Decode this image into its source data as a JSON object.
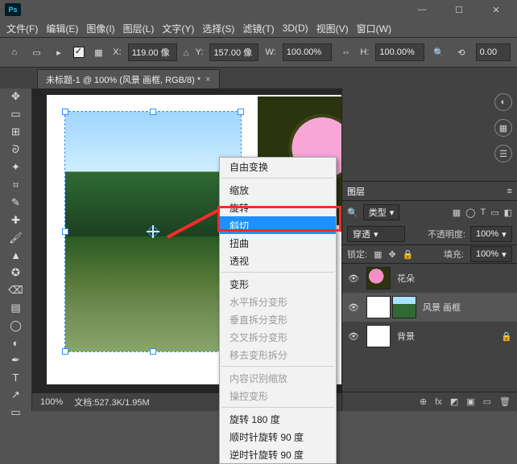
{
  "app": {
    "badge": "Ps"
  },
  "window_controls": {
    "min": "—",
    "max": "☐",
    "close": "✕"
  },
  "menu": [
    "文件(F)",
    "编辑(E)",
    "图像(I)",
    "图层(L)",
    "文字(Y)",
    "选择(S)",
    "滤镜(T)",
    "3D(D)",
    "视图(V)",
    "窗口(W)"
  ],
  "options": {
    "x_label": "X:",
    "x_value": "119.00 像",
    "y_label": "Y:",
    "y_value": "157.00 像",
    "w_label": "W:",
    "w_value": "100.00%",
    "h_label": "H:",
    "h_value": "100.00%",
    "angle": "0.00"
  },
  "doc_tab": {
    "title": "未标题-1 @ 100% (风景 画框, RGB/8) *",
    "close": "×"
  },
  "tools": {
    "move": "✥",
    "marquee": "▭",
    "frame": "⊞",
    "lasso": "ᘐ",
    "wand": "✦",
    "crop": "⌗",
    "eyedrop": "✎",
    "heal": "✚",
    "brush": "🖌",
    "stamp": "▲",
    "history": "✪",
    "eraser": "⌫",
    "grad": "▤",
    "blur": "◯",
    "dodge": "◐",
    "pen": "✒",
    "type": "T",
    "path": "↗",
    "shape": "▭",
    "hand": "✋",
    "zoom": "🔍"
  },
  "status": {
    "zoom": "100%",
    "doc": "文档:527.3K/1.95M"
  },
  "context_menu": {
    "free": "自由变换",
    "scale": "缩放",
    "rotate": "旋转",
    "skew": "斜切",
    "distort": "扭曲",
    "perspective": "透视",
    "warp": "变形",
    "hwarp": "水平拆分变形",
    "vwarp": "垂直拆分变形",
    "xwarp": "交叉拆分变形",
    "rmwarp": "移去变形拆分",
    "cas": "内容识别缩放",
    "puppet": "操控变形",
    "r180": "旋转 180 度",
    "rcw": "顺时针旋转 90 度",
    "rccw": "逆时针旋转 90 度"
  },
  "panels": {
    "tab_layers": "图层",
    "search_ph": "类型",
    "kind_icons": [
      "▦",
      "◯",
      "T",
      "▭",
      "◧"
    ],
    "blend": "穿透",
    "opacity_label": "不透明度:",
    "opacity": "100%",
    "lock_label": "锁定:",
    "fill_label": "填充:",
    "fill": "100%",
    "layer_flowers": "花朵",
    "layer_frame": "风景 画框",
    "layer_bg": "背景",
    "footer": [
      "⊕",
      "fx",
      "◩",
      "▣",
      "▭",
      "🗑"
    ]
  }
}
